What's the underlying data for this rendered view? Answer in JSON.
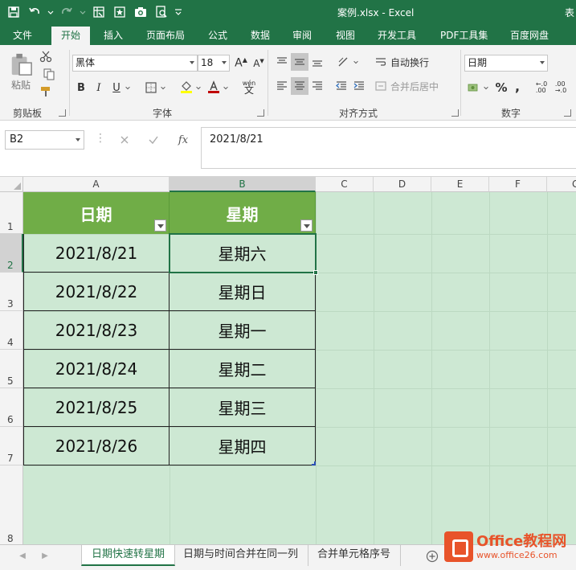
{
  "window": {
    "title": "案例.xlsx - Excel",
    "title_right_fragment": "表"
  },
  "ribbon_tabs": [
    {
      "label": "文件"
    },
    {
      "label": "开始"
    },
    {
      "label": "插入"
    },
    {
      "label": "页面布局"
    },
    {
      "label": "公式"
    },
    {
      "label": "数据"
    },
    {
      "label": "审阅"
    },
    {
      "label": "视图"
    },
    {
      "label": "开发工具"
    },
    {
      "label": "PDF工具集"
    },
    {
      "label": "百度网盘"
    }
  ],
  "active_tab": "开始",
  "ribbon": {
    "clipboard": {
      "paste_label": "粘贴",
      "group_label": "剪贴板"
    },
    "font": {
      "font_name": "黑体",
      "font_size": "18",
      "group_label": "字体",
      "bold": "B",
      "italic": "I",
      "underline": "U",
      "wen_label": "wén"
    },
    "alignment": {
      "wrap_label": "自动换行",
      "merge_label": "合并后居中",
      "group_label": "对齐方式"
    },
    "number": {
      "format": "日期",
      "percent": "%",
      "comma": ",",
      "group_label": "数字"
    }
  },
  "formula_bar": {
    "name_box": "B2",
    "fx": "fx",
    "value": "2021/8/21"
  },
  "columns": [
    "A",
    "B",
    "C",
    "D",
    "E",
    "F",
    "G"
  ],
  "rows": [
    "1",
    "2",
    "3",
    "4",
    "5",
    "6",
    "7",
    "8"
  ],
  "table": {
    "headers": [
      "日期",
      "星期"
    ],
    "rows": [
      [
        "2021/8/21",
        "星期六"
      ],
      [
        "2021/8/22",
        "星期日"
      ],
      [
        "2021/8/23",
        "星期一"
      ],
      [
        "2021/8/24",
        "星期二"
      ],
      [
        "2021/8/25",
        "星期三"
      ],
      [
        "2021/8/26",
        "星期四"
      ]
    ]
  },
  "sheet_tabs": [
    {
      "label": "日期快速转星期",
      "active": true
    },
    {
      "label": "日期与时间合并在同一列",
      "active": false
    },
    {
      "label": "合并单元格序号",
      "active": false
    }
  ],
  "watermark": {
    "line1": "Office教程网",
    "line2": "www.office26.com"
  },
  "colors": {
    "excel_green": "#217346",
    "header_fill": "#70ad47",
    "sheet_bg": "#cde8d3",
    "font_red": "#c00000",
    "highlight_yellow": "#ffff00"
  }
}
